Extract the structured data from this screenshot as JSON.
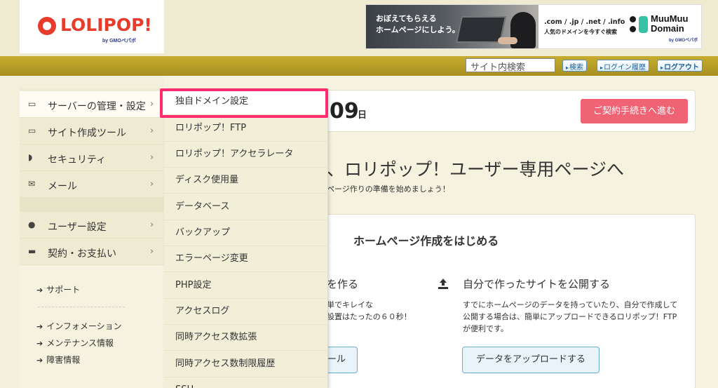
{
  "header": {
    "logo": {
      "name": "LOLIPOP!",
      "by": "by GMOペパボ"
    },
    "banner": {
      "tagline_line1": "おぼえてもらえる",
      "tagline_line2": "ホームページにしよう。",
      "domains": ".com / .jp / .net / .info",
      "domains_sub": "人気のドメインを今すぐ検索",
      "brand_line1": "MuuMuu",
      "brand_line2": "Domain",
      "brand_by": "by GMOペパボ"
    },
    "search": {
      "value": "サイト内検索"
    },
    "buttons": {
      "search": "検索",
      "login_history": "ログイン履歴",
      "logout": "ログアウト"
    }
  },
  "sidebar": {
    "items": [
      {
        "label": "サーバーの管理・設定",
        "icon": "server-icon",
        "active": true
      },
      {
        "label": "サイト作成ツール",
        "icon": "monitor-icon"
      },
      {
        "label": "セキュリティ",
        "icon": "shield-icon"
      },
      {
        "label": "メール",
        "icon": "mail-icon"
      },
      {
        "label": "ユーザー設定",
        "icon": "user-icon"
      },
      {
        "label": "契約・お支払い",
        "icon": "card-icon"
      }
    ],
    "links": [
      "サポート",
      "インフォメーション",
      "メンテナンス情報",
      "障害情報"
    ]
  },
  "dropdown": {
    "items": [
      "独自ドメイン設定",
      "ロリポップ！FTP",
      "ロリポップ！アクセラレータ",
      "ディスク使用量",
      "データベース",
      "バックアップ",
      "エラーページ変更",
      "PHP設定",
      "アクセスログ",
      "同時アクセス数拡張",
      "同時アクセス数制限履歴",
      "SSH"
    ],
    "highlight_color": "#ff2d6f"
  },
  "main": {
    "contract": {
      "days": "09",
      "unit": "日",
      "button": "ご契約手続きへ進む"
    },
    "welcome": "、ロリポップ！ユーザー専用ページへ",
    "welcome_sub": "ページ作りの準備を始めましょう！",
    "homepage": {
      "title": "ホームページ作成をはじめる",
      "col1": {
        "title": "を作る",
        "line1": "単でキレイな",
        "line2": "設置はたったの６０秒！",
        "button": "ール"
      },
      "col2": {
        "title": "自分で作ったサイトを公開する",
        "text": "すでにホームページのデータを持っていたり、自分で作成して公開する場合は、簡単にアップロードできるロリポップ！FTPが便利です。",
        "button": "データをアップロードする"
      }
    }
  },
  "colors": {
    "accent_red": "#ef6374",
    "olive_bar": "#b39b27",
    "logo_red": "#e83b2b"
  }
}
